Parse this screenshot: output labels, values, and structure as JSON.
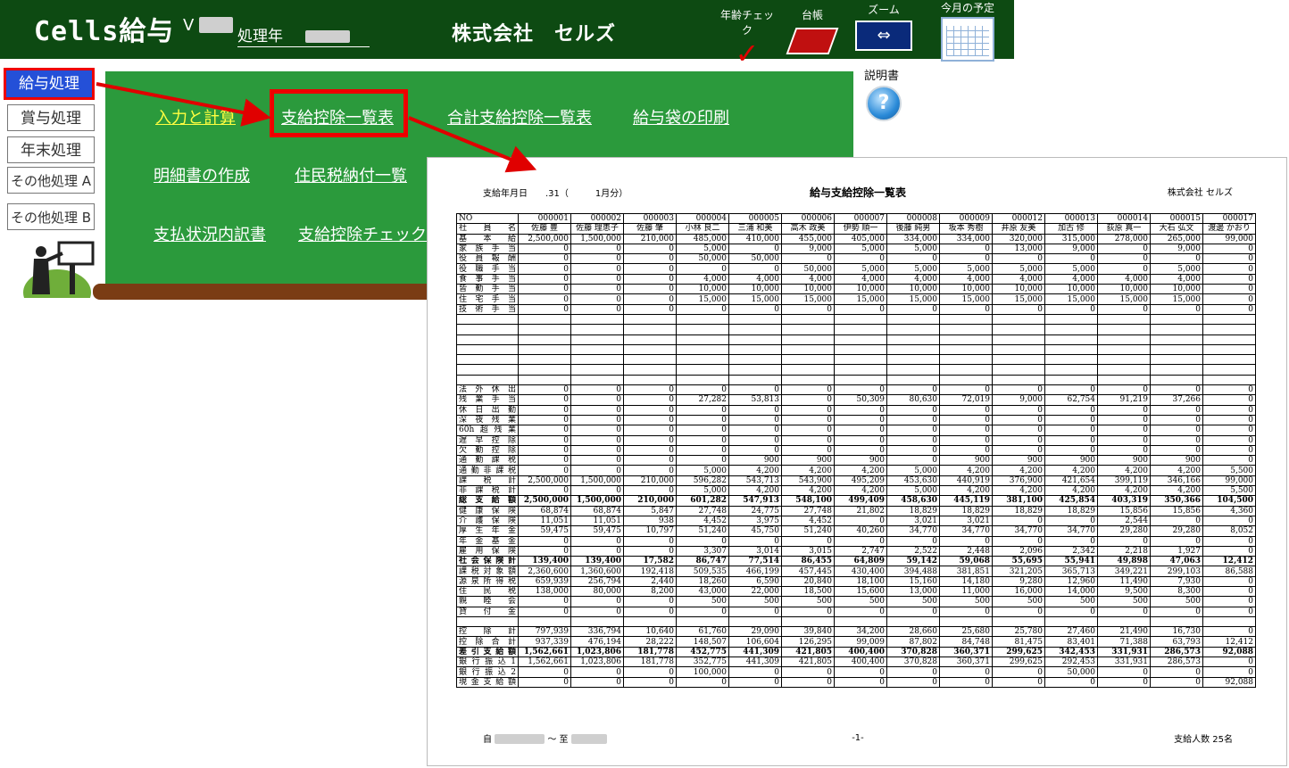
{
  "app": {
    "title": "Cells給与",
    "version_prefix": "V",
    "year_label": "処理年",
    "company": "株式会社　セルズ"
  },
  "toolbar": {
    "age_check": "年齢チェック",
    "ledger": "台帳",
    "zoom": "ズーム",
    "schedule": "今月の予定"
  },
  "side_menu": [
    "給与処理",
    "賞与処理",
    "年末処理",
    "その他処理 A",
    "その他処理 B"
  ],
  "main_menu": {
    "input_calc": "入力と計算",
    "pay_deduction_list": "支給控除一覧表",
    "total_pay_deduction_list": "合計支給控除一覧表",
    "payslip_print": "給与袋の印刷",
    "statement": "明細書の作成",
    "resident_tax": "住民税納付一覧",
    "payment_breakdown": "支払状況内訳書",
    "pay_deduction_check": "支給控除チェック"
  },
  "help": {
    "label": "説明書"
  },
  "colors": {
    "topbar": "#0d4a12",
    "panel": "#2b9a3c",
    "highlight": "#e00000",
    "active_button": "#2450d8"
  },
  "report": {
    "date_label": "支給年月日　　.31（　　　1月分）",
    "title": "給与支給控除一覧表",
    "company": "株式会社 セルズ",
    "footer_from": "自",
    "footer_to": "～ 至",
    "page": "-1-",
    "count": "支給人数 25名",
    "no_label": "NO",
    "name_label": "社員名",
    "employee_nos": [
      "000001",
      "000002",
      "000003",
      "000004",
      "000005",
      "000006",
      "000007",
      "000008",
      "000009",
      "000012",
      "000013",
      "000014",
      "000015",
      "000017"
    ],
    "employee_names": [
      "佐藤 豊",
      "佐藤 理恵子",
      "佐藤 肇",
      "小林 良二",
      "三浦 和美",
      "高木 政美",
      "伊勢 順一",
      "後藤 純男",
      "坂本 秀樹",
      "井原 友美",
      "加古 修",
      "荻原 真一",
      "大石 弘文",
      "渡邊 かおり"
    ],
    "rows": [
      {
        "label": "基本給",
        "v": [
          "2,500,000",
          "1,500,000",
          "210,000",
          "485,000",
          "410,000",
          "455,000",
          "405,000",
          "334,000",
          "334,000",
          "320,000",
          "315,000",
          "278,000",
          "265,000",
          "99,000"
        ]
      },
      {
        "label": "家族手当",
        "v": [
          "0",
          "0",
          "0",
          "5,000",
          "0",
          "9,000",
          "5,000",
          "5,000",
          "0",
          "13,000",
          "9,000",
          "0",
          "9,000",
          "0"
        ]
      },
      {
        "label": "役員報酬",
        "v": [
          "0",
          "0",
          "0",
          "50,000",
          "50,000",
          "0",
          "0",
          "0",
          "0",
          "0",
          "0",
          "0",
          "0",
          "0"
        ]
      },
      {
        "label": "役職手当",
        "v": [
          "0",
          "0",
          "0",
          "0",
          "0",
          "50,000",
          "5,000",
          "5,000",
          "5,000",
          "5,000",
          "5,000",
          "0",
          "5,000",
          "0"
        ]
      },
      {
        "label": "食事手当",
        "v": [
          "0",
          "0",
          "0",
          "4,000",
          "4,000",
          "4,000",
          "4,000",
          "4,000",
          "4,000",
          "4,000",
          "4,000",
          "4,000",
          "4,000",
          "0"
        ]
      },
      {
        "label": "皆勤手当",
        "v": [
          "0",
          "0",
          "0",
          "10,000",
          "10,000",
          "10,000",
          "10,000",
          "10,000",
          "10,000",
          "10,000",
          "10,000",
          "10,000",
          "10,000",
          "0"
        ]
      },
      {
        "label": "住宅手当",
        "v": [
          "0",
          "0",
          "0",
          "15,000",
          "15,000",
          "15,000",
          "15,000",
          "15,000",
          "15,000",
          "15,000",
          "15,000",
          "15,000",
          "15,000",
          "0"
        ]
      },
      {
        "label": "技術手当",
        "v": [
          "0",
          "0",
          "0",
          "0",
          "0",
          "0",
          "0",
          "0",
          "0",
          "0",
          "0",
          "0",
          "0",
          "0"
        ]
      },
      {
        "label": "",
        "v": [
          "",
          "",
          "",
          "",
          "",
          "",
          "",
          "",
          "",
          "",
          "",
          "",
          "",
          ""
        ]
      },
      {
        "label": "",
        "v": [
          "",
          "",
          "",
          "",
          "",
          "",
          "",
          "",
          "",
          "",
          "",
          "",
          "",
          ""
        ]
      },
      {
        "label": "",
        "v": [
          "",
          "",
          "",
          "",
          "",
          "",
          "",
          "",
          "",
          "",
          "",
          "",
          "",
          ""
        ]
      },
      {
        "label": "",
        "v": [
          "",
          "",
          "",
          "",
          "",
          "",
          "",
          "",
          "",
          "",
          "",
          "",
          "",
          ""
        ]
      },
      {
        "label": "",
        "v": [
          "",
          "",
          "",
          "",
          "",
          "",
          "",
          "",
          "",
          "",
          "",
          "",
          "",
          ""
        ]
      },
      {
        "label": "",
        "v": [
          "",
          "",
          "",
          "",
          "",
          "",
          "",
          "",
          "",
          "",
          "",
          "",
          "",
          ""
        ]
      },
      {
        "label": "",
        "v": [
          "",
          "",
          "",
          "",
          "",
          "",
          "",
          "",
          "",
          "",
          "",
          "",
          "",
          ""
        ]
      },
      {
        "label": "法外休出",
        "v": [
          "0",
          "0",
          "0",
          "0",
          "0",
          "0",
          "0",
          "0",
          "0",
          "0",
          "0",
          "0",
          "0",
          "0"
        ]
      },
      {
        "label": "残業手当",
        "v": [
          "0",
          "0",
          "0",
          "27,282",
          "53,813",
          "0",
          "50,309",
          "80,630",
          "72,019",
          "9,000",
          "62,754",
          "91,219",
          "37,266",
          "0"
        ]
      },
      {
        "label": "休日出勤",
        "v": [
          "0",
          "0",
          "0",
          "0",
          "0",
          "0",
          "0",
          "0",
          "0",
          "0",
          "0",
          "0",
          "0",
          "0"
        ]
      },
      {
        "label": "深夜残業",
        "v": [
          "0",
          "0",
          "0",
          "0",
          "0",
          "0",
          "0",
          "0",
          "0",
          "0",
          "0",
          "0",
          "0",
          "0"
        ]
      },
      {
        "label": "60h超残業",
        "v": [
          "0",
          "0",
          "0",
          "0",
          "0",
          "0",
          "0",
          "0",
          "0",
          "0",
          "0",
          "0",
          "0",
          "0"
        ]
      },
      {
        "label": "遅早控除",
        "v": [
          "0",
          "0",
          "0",
          "0",
          "0",
          "0",
          "0",
          "0",
          "0",
          "0",
          "0",
          "0",
          "0",
          "0"
        ]
      },
      {
        "label": "欠勤控除",
        "v": [
          "0",
          "0",
          "0",
          "0",
          "0",
          "0",
          "0",
          "0",
          "0",
          "0",
          "0",
          "0",
          "0",
          "0"
        ]
      },
      {
        "label": "通勤課税",
        "v": [
          "0",
          "0",
          "0",
          "0",
          "900",
          "900",
          "900",
          "0",
          "900",
          "900",
          "900",
          "900",
          "900",
          "0"
        ]
      },
      {
        "label": "通勤非課税",
        "v": [
          "0",
          "0",
          "0",
          "5,000",
          "4,200",
          "4,200",
          "4,200",
          "5,000",
          "4,200",
          "4,200",
          "4,200",
          "4,200",
          "4,200",
          "5,500"
        ]
      },
      {
        "label": "課税計",
        "v": [
          "2,500,000",
          "1,500,000",
          "210,000",
          "596,282",
          "543,713",
          "543,900",
          "495,209",
          "453,630",
          "440,919",
          "376,900",
          "421,654",
          "399,119",
          "346,166",
          "99,000"
        ]
      },
      {
        "label": "非課税計",
        "v": [
          "0",
          "0",
          "0",
          "5,000",
          "4,200",
          "4,200",
          "4,200",
          "5,000",
          "4,200",
          "4,200",
          "4,200",
          "4,200",
          "4,200",
          "5,500"
        ]
      },
      {
        "label": "総支給額",
        "bold": true,
        "v": [
          "2,500,000",
          "1,500,000",
          "210,000",
          "601,282",
          "547,913",
          "548,100",
          "499,409",
          "458,630",
          "445,119",
          "381,100",
          "425,854",
          "403,319",
          "350,366",
          "104,500"
        ]
      },
      {
        "label": "健康保険",
        "v": [
          "68,874",
          "68,874",
          "5,847",
          "27,748",
          "24,775",
          "27,748",
          "21,802",
          "18,829",
          "18,829",
          "18,829",
          "18,829",
          "15,856",
          "15,856",
          "4,360"
        ]
      },
      {
        "label": "介護保険",
        "v": [
          "11,051",
          "11,051",
          "938",
          "4,452",
          "3,975",
          "4,452",
          "0",
          "3,021",
          "3,021",
          "0",
          "0",
          "2,544",
          "0",
          "0"
        ]
      },
      {
        "label": "厚生年金",
        "v": [
          "59,475",
          "59,475",
          "10,797",
          "51,240",
          "45,750",
          "51,240",
          "40,260",
          "34,770",
          "34,770",
          "34,770",
          "34,770",
          "29,280",
          "29,280",
          "8,052"
        ]
      },
      {
        "label": "年金基金",
        "v": [
          "0",
          "0",
          "0",
          "0",
          "0",
          "0",
          "0",
          "0",
          "0",
          "0",
          "0",
          "0",
          "0",
          "0"
        ]
      },
      {
        "label": "雇用保険",
        "v": [
          "0",
          "0",
          "0",
          "3,307",
          "3,014",
          "3,015",
          "2,747",
          "2,522",
          "2,448",
          "2,096",
          "2,342",
          "2,218",
          "1,927",
          "0"
        ]
      },
      {
        "label": "社会保険計",
        "bold": true,
        "v": [
          "139,400",
          "139,400",
          "17,582",
          "86,747",
          "77,514",
          "86,455",
          "64,809",
          "59,142",
          "59,068",
          "55,695",
          "55,941",
          "49,898",
          "47,063",
          "12,412"
        ]
      },
      {
        "label": "課税対象額",
        "v": [
          "2,360,600",
          "1,360,600",
          "192,418",
          "509,535",
          "466,199",
          "457,445",
          "430,400",
          "394,488",
          "381,851",
          "321,205",
          "365,713",
          "349,221",
          "299,103",
          "86,588"
        ]
      },
      {
        "label": "源泉所得税",
        "v": [
          "659,939",
          "256,794",
          "2,440",
          "18,260",
          "6,590",
          "20,840",
          "18,100",
          "15,160",
          "14,180",
          "9,280",
          "12,960",
          "11,490",
          "7,930",
          "0"
        ]
      },
      {
        "label": "住民税",
        "v": [
          "138,000",
          "80,000",
          "8,200",
          "43,000",
          "22,000",
          "18,500",
          "15,600",
          "13,000",
          "11,000",
          "16,000",
          "14,000",
          "9,500",
          "8,300",
          "0"
        ]
      },
      {
        "label": "親睦会",
        "v": [
          "0",
          "0",
          "0",
          "500",
          "500",
          "500",
          "500",
          "500",
          "500",
          "500",
          "500",
          "500",
          "500",
          "0"
        ]
      },
      {
        "label": "貸付金",
        "v": [
          "0",
          "0",
          "0",
          "0",
          "0",
          "0",
          "0",
          "0",
          "0",
          "0",
          "0",
          "0",
          "0",
          "0"
        ]
      },
      {
        "label": "",
        "v": [
          "",
          "",
          "",
          "",
          "",
          "",
          "",
          "",
          "",
          "",
          "",
          "",
          "",
          ""
        ]
      },
      {
        "label": "控除計",
        "v": [
          "797,939",
          "336,794",
          "10,640",
          "61,760",
          "29,090",
          "39,840",
          "34,200",
          "28,660",
          "25,680",
          "25,780",
          "27,460",
          "21,490",
          "16,730",
          "0"
        ]
      },
      {
        "label": "控除合計",
        "v": [
          "937,339",
          "476,194",
          "28,222",
          "148,507",
          "106,604",
          "126,295",
          "99,009",
          "87,802",
          "84,748",
          "81,475",
          "83,401",
          "71,388",
          "63,793",
          "12,412"
        ]
      },
      {
        "label": "差引支給額",
        "bold": true,
        "v": [
          "1,562,661",
          "1,023,806",
          "181,778",
          "452,775",
          "441,309",
          "421,805",
          "400,400",
          "370,828",
          "360,371",
          "299,625",
          "342,453",
          "331,931",
          "286,573",
          "92,088"
        ]
      },
      {
        "label": "銀行振込1",
        "v": [
          "1,562,661",
          "1,023,806",
          "181,778",
          "352,775",
          "441,309",
          "421,805",
          "400,400",
          "370,828",
          "360,371",
          "299,625",
          "292,453",
          "331,931",
          "286,573",
          "0"
        ]
      },
      {
        "label": "銀行振込2",
        "v": [
          "0",
          "0",
          "0",
          "100,000",
          "0",
          "0",
          "0",
          "0",
          "0",
          "0",
          "50,000",
          "0",
          "0",
          "0"
        ]
      },
      {
        "label": "現金支給額",
        "v": [
          "0",
          "0",
          "0",
          "0",
          "0",
          "0",
          "0",
          "0",
          "0",
          "0",
          "0",
          "0",
          "0",
          "92,088"
        ]
      }
    ]
  }
}
